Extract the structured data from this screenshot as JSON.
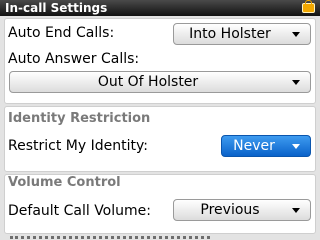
{
  "app": {
    "title": "In-call Settings"
  },
  "status": {
    "battery_icon": "battery-icon",
    "battery_color": "#f2a800"
  },
  "holster": {
    "auto_end_label": "Auto End Calls:",
    "auto_end_value": "Into Holster",
    "auto_answer_label": "Auto Answer Calls:",
    "auto_answer_value": "Out Of Holster"
  },
  "identity": {
    "section_title": "Identity Restriction",
    "restrict_label": "Restrict My Identity:",
    "restrict_value": "Never"
  },
  "volume": {
    "section_title": "Volume Control",
    "default_label": "Default Call Volume:",
    "default_value": "Previous"
  },
  "colors": {
    "title_bar": "#111111",
    "selection": "#0a62c9",
    "section_title": "#7a7a7a"
  }
}
